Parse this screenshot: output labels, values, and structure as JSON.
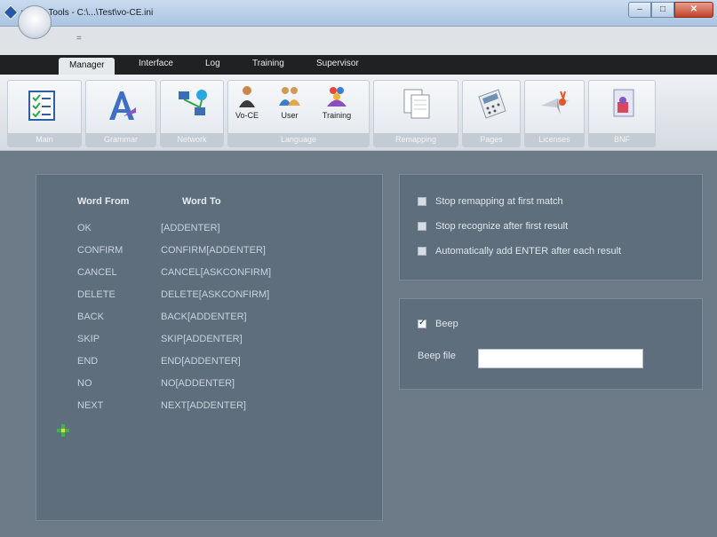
{
  "window": {
    "title": "vo-CE Tools - C:\\...\\Test\\vo-CE.ini",
    "minimize": "–",
    "maximize": "□",
    "close": "✕"
  },
  "qat": {
    "arrow": "="
  },
  "orb_text": "",
  "tabs": [
    {
      "label": "Manager",
      "active": true
    },
    {
      "label": "Interface"
    },
    {
      "label": "Log"
    },
    {
      "label": "Training"
    },
    {
      "label": "Supervisor"
    }
  ],
  "ribbon": {
    "groups": [
      "Main",
      "Grammar",
      "Network",
      "Language",
      "Remapping",
      "Pages",
      "Licenses",
      "BNF"
    ],
    "language_buttons": [
      "Vo-CE",
      "User",
      "Training"
    ]
  },
  "remap": {
    "headers": {
      "from": "Word From",
      "to": "Word To"
    },
    "rows": [
      {
        "from": "OK",
        "to": "[ADDENTER]"
      },
      {
        "from": "CONFIRM",
        "to": "CONFIRM[ADDENTER]"
      },
      {
        "from": "CANCEL",
        "to": "CANCEL[ASKCONFIRM]"
      },
      {
        "from": "DELETE",
        "to": "DELETE[ASKCONFIRM]"
      },
      {
        "from": "BACK",
        "to": "BACK[ADDENTER]"
      },
      {
        "from": "SKIP",
        "to": "SKIP[ADDENTER]"
      },
      {
        "from": "END",
        "to": "END[ADDENTER]"
      },
      {
        "from": "NO",
        "to": "NO[ADDENTER]"
      },
      {
        "from": "NEXT",
        "to": "NEXT[ADDENTER]"
      }
    ]
  },
  "options": [
    {
      "label": "Stop remapping at first match",
      "checked": false
    },
    {
      "label": "Stop recognize after first result",
      "checked": false
    },
    {
      "label": "Automatically add ENTER after each result",
      "checked": false
    }
  ],
  "beep": {
    "label": "Beep",
    "checked": true,
    "file_label": "Beep file",
    "file_value": ""
  }
}
